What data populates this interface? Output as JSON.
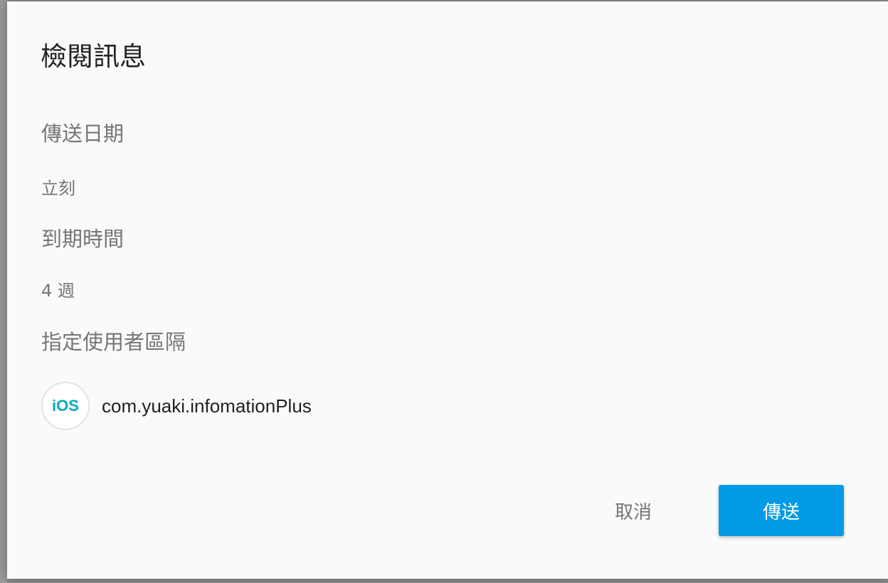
{
  "dialog": {
    "title": "檢閱訊息",
    "send_date": {
      "heading": "傳送日期",
      "value": "立刻"
    },
    "expiration": {
      "heading": "到期時間",
      "value": "4 週"
    },
    "target_segment": {
      "heading": "指定使用者區隔",
      "platform_icon": "ios-icon",
      "platform_label": "iOS",
      "app_id": "com.yuaki.infomationPlus"
    },
    "actions": {
      "cancel_label": "取消",
      "send_label": "傳送"
    }
  },
  "colors": {
    "primary_button": "#039be5",
    "ios_badge": "#00acc1",
    "secondary_text": "#757575",
    "primary_text": "#212121",
    "dialog_background": "#fafafa"
  }
}
